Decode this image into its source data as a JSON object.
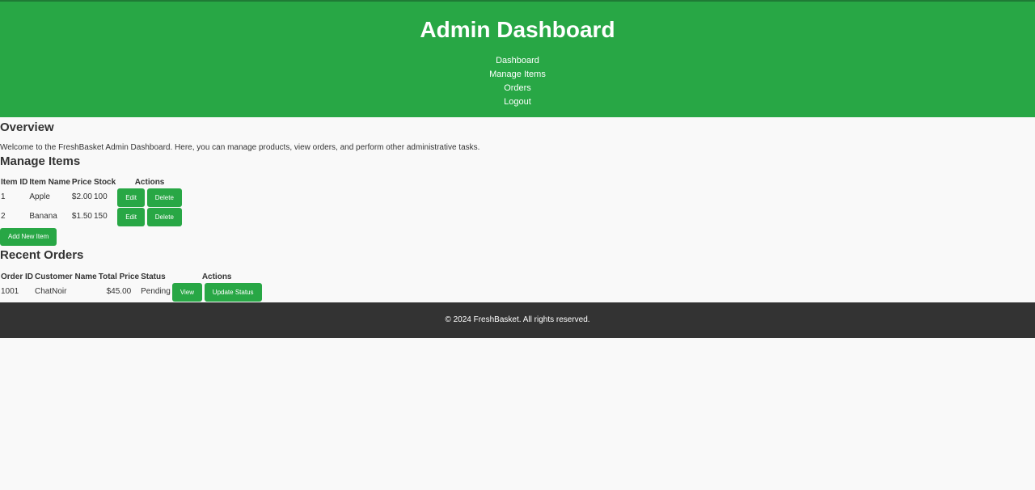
{
  "header": {
    "title": "Admin Dashboard",
    "nav": [
      "Dashboard",
      "Manage Items",
      "Orders",
      "Logout"
    ]
  },
  "overview": {
    "title": "Overview",
    "text": "Welcome to the FreshBasket Admin Dashboard. Here, you can manage products, view orders, and perform other administrative tasks."
  },
  "items": {
    "title": "Manage Items",
    "columns": [
      "Item ID",
      "Item Name",
      "Price",
      "Stock",
      "Actions"
    ],
    "rows": [
      {
        "id": "1",
        "name": "Apple",
        "price": "$2.00",
        "stock": "100"
      },
      {
        "id": "2",
        "name": "Banana",
        "price": "$1.50",
        "stock": "150"
      }
    ],
    "edit_label": "Edit",
    "delete_label": "Delete",
    "add_label": "Add New Item"
  },
  "orders": {
    "title": "Recent Orders",
    "columns": [
      "Order ID",
      "Customer Name",
      "Total Price",
      "Status",
      "Actions"
    ],
    "rows": [
      {
        "id": "1001",
        "customer": "ChatNoir",
        "total": "$45.00",
        "status": "Pending"
      }
    ],
    "view_label": "View",
    "update_label": "Update Status"
  },
  "footer": {
    "text": "© 2024 FreshBasket. All rights reserved."
  },
  "colors": {
    "primary": "#28a745",
    "footer": "#333333",
    "background": "#f9f9f9"
  }
}
